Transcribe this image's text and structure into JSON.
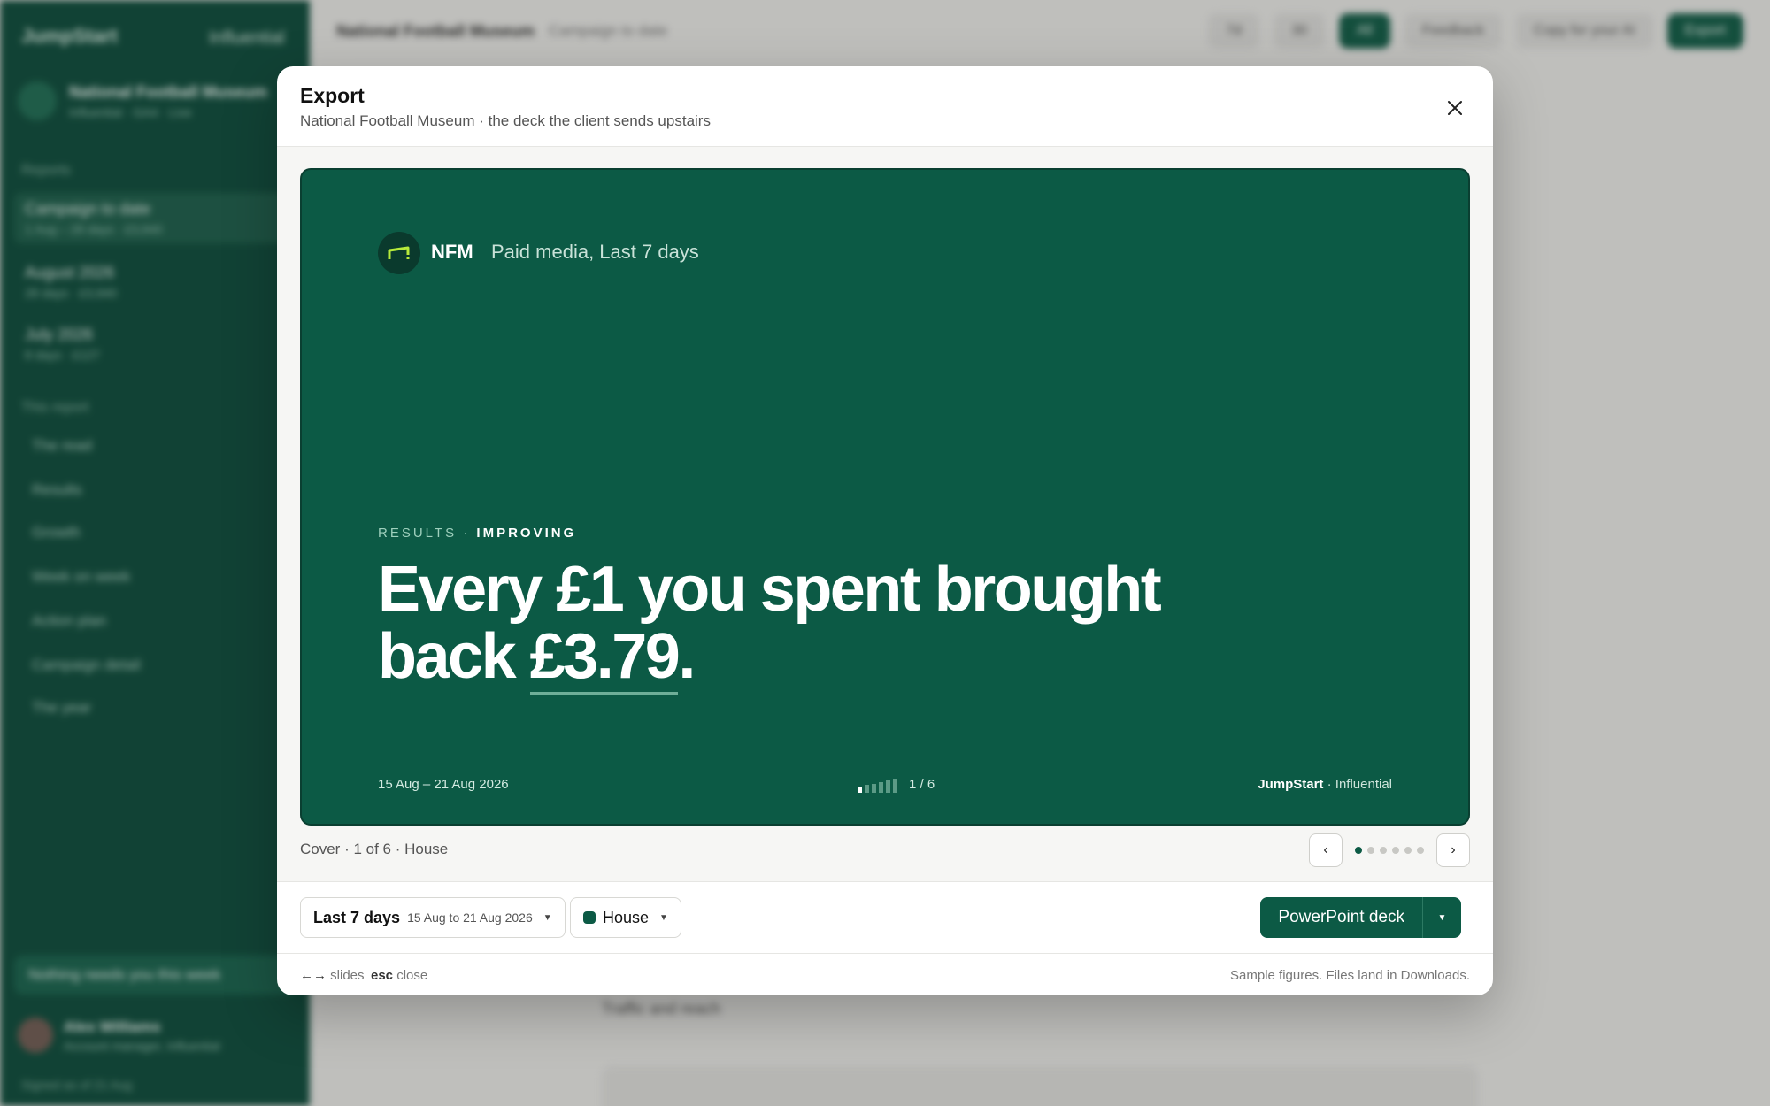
{
  "background": {
    "brand": "JumpStart",
    "brand_partner": "Influential",
    "client_name": "National Football Museum",
    "client_meta": "Influential · GA4 · Live",
    "section_reports": "Reports",
    "reports": [
      {
        "title": "Campaign to date",
        "meta": "1 Aug – 28 days · £3,840"
      },
      {
        "title": "August 2026",
        "meta": "28 days · £3,840"
      },
      {
        "title": "July 2026",
        "meta": "8 days · £127"
      }
    ],
    "section_this_report": "This report",
    "sub_items": [
      "The read",
      "Results",
      "Growth",
      "Week on week",
      "Action plan",
      "Campaign detail",
      "The year"
    ],
    "status": "Nothing needs you this week",
    "user_name": "Alex Williams",
    "user_role": "Account manager, Influential",
    "footer": "Signed as of 21 Aug",
    "top_crumb": "National Football Museum",
    "top_crumb2": "Campaign to date",
    "top_pills": [
      "7d",
      "30",
      "All",
      "Feedback",
      "Copy for your AI",
      "Export"
    ],
    "section_heading": "Traffic and reach"
  },
  "modal": {
    "title": "Export",
    "subtitle": "National Football Museum · the deck the client sends upstairs",
    "close_icon": "close-icon"
  },
  "slide": {
    "org": "NFM",
    "subtitle": "Paid media, Last 7 days",
    "kicker_a": "RESULTS ·",
    "kicker_b": "IMPROVING",
    "headline_pre": "Every £1 you spent brought back ",
    "headline_value": "£3.79",
    "headline_post": ".",
    "dates": "15 Aug – 21 Aug 2026",
    "page": "1 / 6",
    "credit_brand": "JumpStart",
    "credit_sep": " · ",
    "credit_partner": "Influential",
    "progress_current": 1,
    "progress_total": 6
  },
  "caption": "Cover · 1 of 6 · House",
  "pager": {
    "prev": "‹",
    "next": "›",
    "current": 1,
    "total": 6
  },
  "controls": {
    "period_label": "Last 7 days",
    "period_range": "15 Aug to 21 Aug 2026",
    "theme_label": "House",
    "theme_color": "#0c5a45",
    "export_label": "PowerPoint deck"
  },
  "footer": {
    "arrows_key": "←→",
    "arrows_label": "slides",
    "esc_key": "esc",
    "esc_label": "close",
    "note": "Sample figures. Files land in Downloads."
  },
  "colors": {
    "brand_green": "#0c5a45",
    "accent_lime": "#b6ea3b"
  }
}
